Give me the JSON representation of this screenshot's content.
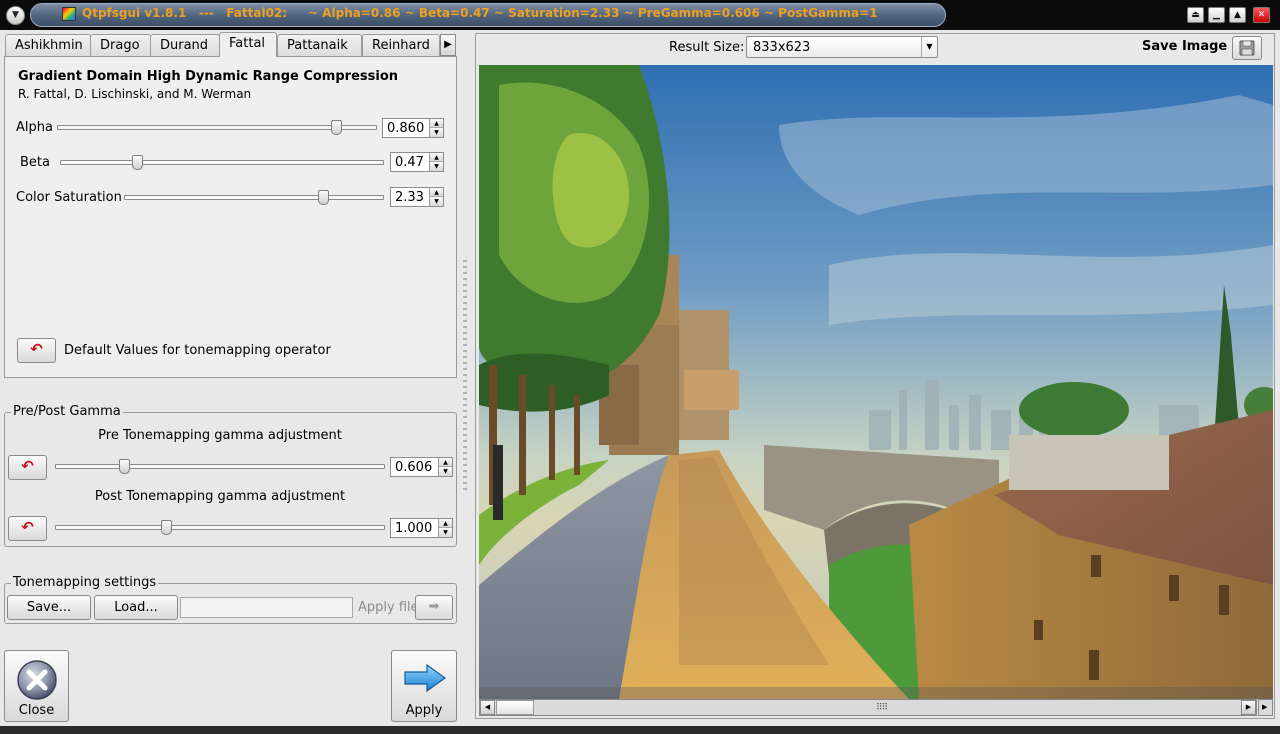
{
  "window": {
    "title": "Qtpfsgui v1.8.1   ---   Fattal02:     ~ Alpha=0.86 ~ Beta=0.47 ~ Saturation=2.33 ~ PreGamma=0.606 ~ PostGamma=1",
    "menu_icon": "chevron-down-icon",
    "buttons": [
      "restore-icon",
      "minimize-icon",
      "maximize-icon",
      "close-icon"
    ]
  },
  "tabs": [
    {
      "label": "Ashikhmin"
    },
    {
      "label": "Drago"
    },
    {
      "label": "Durand"
    },
    {
      "label": "Fattal",
      "active": true
    },
    {
      "label": "Pattanaik"
    },
    {
      "label": "Reinhard"
    }
  ],
  "fattal": {
    "heading": "Gradient Domain High Dynamic Range Compression",
    "authors": "R. Fattal, D. Lischinski, and M. Werman",
    "alpha": {
      "label": "Alpha",
      "value": "0.860",
      "slider_fraction": 0.86
    },
    "beta": {
      "label": "Beta",
      "value": "0.47",
      "slider_fraction": 0.24
    },
    "saturation": {
      "label": "Color Saturation",
      "value": "2.33",
      "slider_fraction": 0.77
    },
    "default_label": "Default Values for tonemapping operator"
  },
  "gamma": {
    "group_title": "Pre/Post Gamma",
    "pre_label": "Pre Tonemapping gamma adjustment",
    "pre_value": "0.606",
    "pre_fraction": 0.21,
    "post_label": "Post Tonemapping gamma adjustment",
    "post_value": "1.000",
    "post_fraction": 0.34
  },
  "settings": {
    "group_title": "Tonemapping settings",
    "save_label": "Save...",
    "load_label": "Load...",
    "file_value": "",
    "apply_file_label": "Apply file"
  },
  "actions": {
    "close_label": "Close",
    "apply_label": "Apply"
  },
  "result": {
    "size_label": "Result Size:",
    "size_value": "833x623",
    "save_image_label": "Save Image"
  }
}
